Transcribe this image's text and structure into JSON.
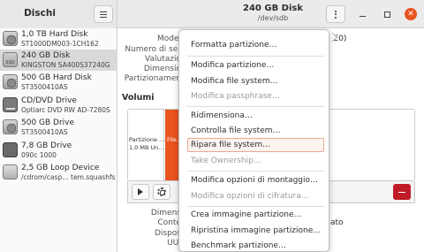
{
  "header": {
    "app_title": "Dischi",
    "disk_title": "240 GB Disk",
    "disk_subtitle": "/dev/sdb"
  },
  "sidebar": {
    "drives": [
      {
        "name": "1,0 TB Hard Disk",
        "model": "ST1000DM003-1CH162",
        "icon": "hard-disk-icon"
      },
      {
        "name": "240 GB Disk",
        "model": "KINGSTON SA400S37240G",
        "icon": "ssd-icon",
        "selected": true
      },
      {
        "name": "500 GB Hard Disk",
        "model": "ST3500410AS",
        "icon": "hard-disk-icon"
      },
      {
        "name": "CD/DVD Drive",
        "model": "Optiarc DVD RW AD-7280S",
        "icon": "optical-drive-icon"
      },
      {
        "name": "500 GB Drive",
        "model": "ST3500410AS",
        "icon": "hard-disk-icon"
      },
      {
        "name": "7,8 GB Drive",
        "model": "090c 1000",
        "icon": "usb-drive-icon"
      },
      {
        "name": "2,5 GB Loop Device",
        "model": "/cdrom/casp… tem.squashfs",
        "icon": "loop-device-icon"
      }
    ]
  },
  "details": {
    "labels": [
      "Model",
      "Numero di ser",
      "Valutazio",
      "Dimensio",
      "Partizionamen"
    ],
    "model_value_fragment": "(E0)",
    "volumes_heading": "Volumi",
    "bottom_labels": [
      "Dimens",
      "Conte",
      "Dispos",
      "UUI"
    ],
    "bottom_value_fragment": "ato"
  },
  "volumes": {
    "partition_label": "Partizione …",
    "partition_size": "1,0 MB Un…",
    "selected_partition_label": "File…"
  },
  "popup_menu": {
    "items": [
      {
        "label": "Formatta partizione…",
        "enabled": true
      },
      {
        "label": "Modifica partizione…",
        "enabled": true
      },
      {
        "label": "Modifica file system…",
        "enabled": true
      },
      {
        "label": "Modifica passphrase…",
        "enabled": false
      },
      {
        "label": "Ridimensiona…",
        "enabled": true
      },
      {
        "label": "Controlla file system…",
        "enabled": true
      },
      {
        "label": "Ripara file system…",
        "enabled": true,
        "hover": true
      },
      {
        "label": "Take Ownership…",
        "enabled": false
      },
      {
        "label": "Modifica opzioni di montaggio…",
        "enabled": true
      },
      {
        "label": "Modifica opzioni di cifratura…",
        "enabled": false
      },
      {
        "label": "Crea immagine partizione…",
        "enabled": true
      },
      {
        "label": "Ripristina immagine partizione…",
        "enabled": true
      },
      {
        "label": "Benchmark partizione…",
        "enabled": true
      }
    ]
  },
  "colors": {
    "accent": "#e95420",
    "delete": "#c01c28",
    "selected_row": "#d9d9d9"
  }
}
